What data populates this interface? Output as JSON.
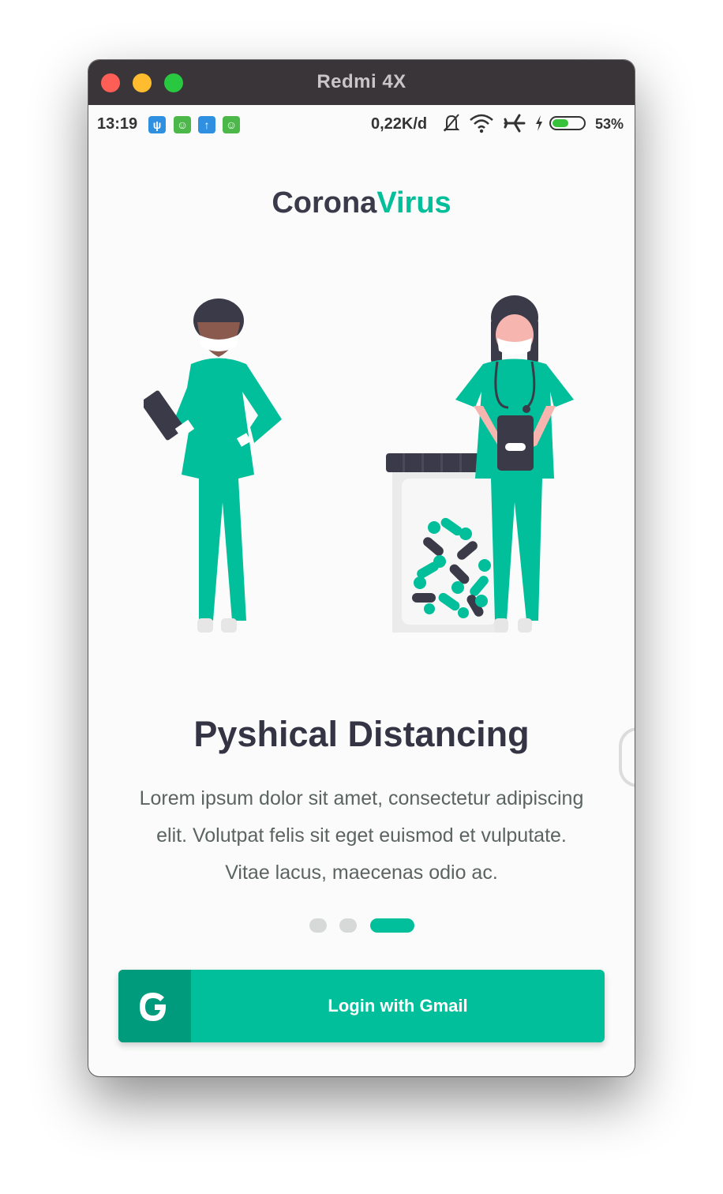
{
  "window": {
    "title": "Redmi 4X"
  },
  "status_bar": {
    "time": "13:19",
    "notification_icons": [
      "mic-icon",
      "android-icon",
      "upload-icon",
      "android-icon"
    ],
    "network_speed": "0,22K/d",
    "icons": [
      "mute-bell-icon",
      "wifi-icon",
      "airplane-mode-icon",
      "charging-icon"
    ],
    "battery_percent": "53%",
    "battery_level": 0.53
  },
  "brand": {
    "part1": "Corona",
    "part2": "Virus",
    "accent_color": "#00bf9a"
  },
  "slide": {
    "title": "Pyshical Distancing",
    "description": "Lorem ipsum dolor sit amet, consectetur adipiscing elit. Volutpat felis sit eget euismod et vulputate. Vitae lacus, maecenas odio ac."
  },
  "pagination": {
    "count": 3,
    "active_index": 2
  },
  "login": {
    "label": "Login with Gmail",
    "icon": "google-g-icon"
  },
  "colors": {
    "primary": "#00bf9a",
    "primary_dark": "#009a7c",
    "text_dark": "#343444"
  }
}
